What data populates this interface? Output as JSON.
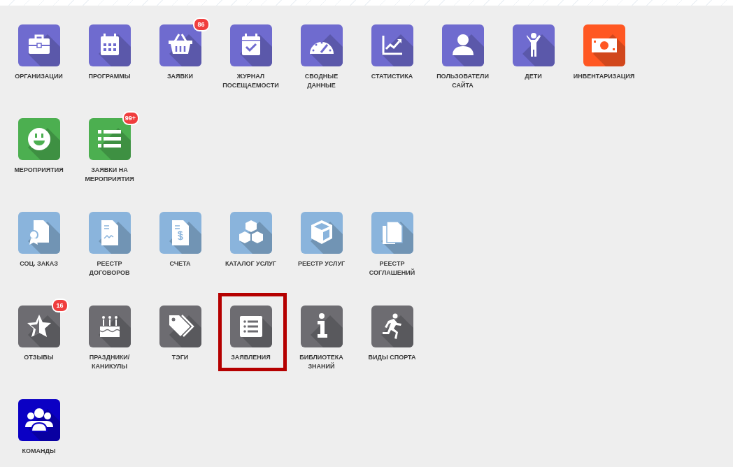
{
  "rows": [
    {
      "tiles": [
        {
          "label": "ОРГАНИЗАЦИИ",
          "color": "#6f6bcf",
          "highlighted": false
        },
        {
          "label": "ПРОГРАММЫ",
          "color": "#6f6bcf",
          "highlighted": false
        },
        {
          "label": "ЗАЯВКИ",
          "color": "#6f6bcf",
          "badge": "86",
          "highlighted": false
        },
        {
          "label": "ЖУРНАЛ ПОСЕЩАЕМОСТИ",
          "color": "#6f6bcf",
          "highlighted": false
        },
        {
          "label": "СВОДНЫЕ ДАННЫЕ",
          "color": "#6f6bcf",
          "highlighted": false
        },
        {
          "label": "СТАТИСТИКА",
          "color": "#6f6bcf",
          "highlighted": false
        },
        {
          "label": "ПОЛЬЗОВАТЕЛИ САЙТА",
          "color": "#6f6bcf",
          "highlighted": false
        },
        {
          "label": "ДЕТИ",
          "color": "#6f6bcf",
          "highlighted": false
        },
        {
          "label": "ИНВЕНТАРИЗАЦИЯ",
          "color": "#ff5722",
          "highlighted": false
        }
      ]
    },
    {
      "tiles": [
        {
          "label": "МЕРОПРИЯТИЯ",
          "color": "#4caf50",
          "highlighted": false
        },
        {
          "label": "ЗАЯВКИ НА МЕРОПРИЯТИЯ",
          "color": "#4caf50",
          "badge": "99+",
          "highlighted": false
        }
      ]
    },
    {
      "tiles": [
        {
          "label": "СОЦ. ЗАКАЗ",
          "color": "#8ab4dc",
          "highlighted": false
        },
        {
          "label": "РЕЕСТР ДОГОВОРОВ",
          "color": "#8ab4dc",
          "highlighted": false
        },
        {
          "label": "СЧЕТА",
          "color": "#8ab4dc",
          "highlighted": false
        },
        {
          "label": "КАТАЛОГ УСЛУГ",
          "color": "#8ab4dc",
          "highlighted": false
        },
        {
          "label": "РЕЕСТР УСЛУГ",
          "color": "#8ab4dc",
          "highlighted": false
        },
        {
          "label": "РЕЕСТР СОГЛАШЕНИЙ",
          "color": "#8ab4dc",
          "highlighted": false
        }
      ]
    },
    {
      "tiles": [
        {
          "label": "ОТЗЫВЫ",
          "color": "#6d6c71",
          "badge": "16",
          "highlighted": false
        },
        {
          "label": "ПРАЗДНИКИ/ КАНИКУЛЫ",
          "color": "#6d6c71",
          "highlighted": false
        },
        {
          "label": "ТЭГИ",
          "color": "#6d6c71",
          "highlighted": false
        },
        {
          "label": "ЗАЯВЛЕНИЯ",
          "color": "#6d6c71",
          "highlighted": true
        },
        {
          "label": "БИБЛИОТЕКА ЗНАНИЙ",
          "color": "#6d6c71",
          "highlighted": false
        },
        {
          "label": "ВИДЫ СПОРТА",
          "color": "#6d6c71",
          "highlighted": false
        }
      ]
    },
    {
      "tiles": [
        {
          "label": "КОМАНДЫ",
          "color": "#0b00c4",
          "highlighted": false
        }
      ]
    }
  ]
}
